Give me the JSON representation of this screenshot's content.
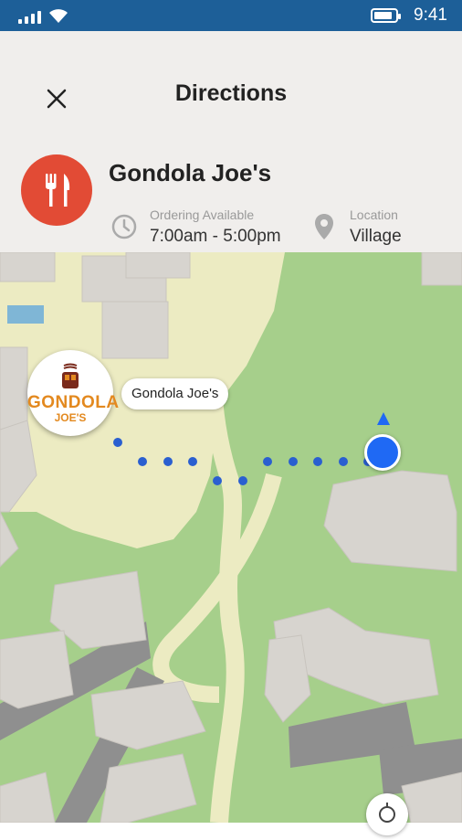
{
  "status_bar": {
    "time": "9:41",
    "battery_level": 0.85
  },
  "header": {
    "title": "Directions",
    "close_icon": "close-icon"
  },
  "place": {
    "name": "Gondola Joe's",
    "avatar_icon": "fork-knife-icon",
    "avatar_color": "#e24b35",
    "ordering_label": "Ordering Available",
    "ordering_value": "7:00am - 5:00pm",
    "location_label": "Location",
    "location_value": "Village"
  },
  "map": {
    "pin_logo_line1": "GONDOLA",
    "pin_logo_line2": "JOE'S",
    "pin_label": "Gondola Joe's",
    "route_color": "#2a5fd0",
    "user_dot_color": "#1f69f4"
  }
}
